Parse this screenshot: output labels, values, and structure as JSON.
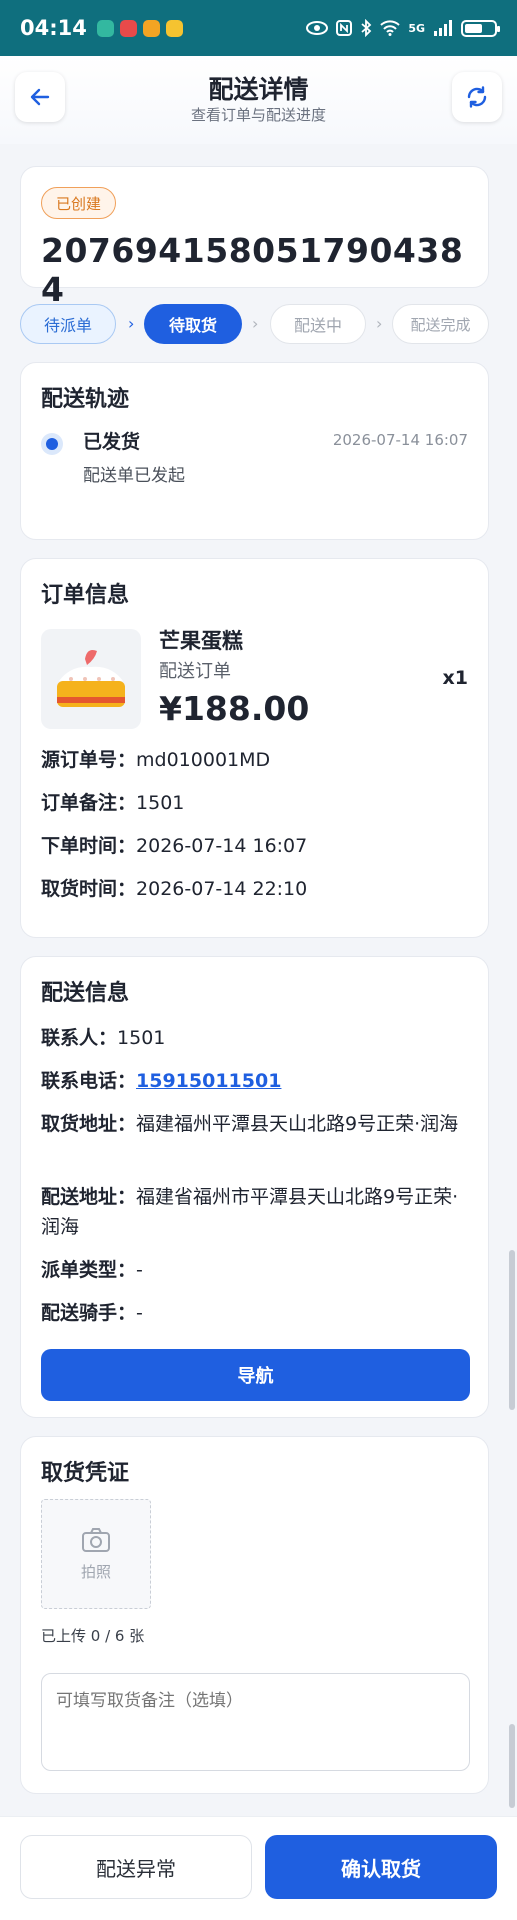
{
  "status_bar": {
    "time": "04:14",
    "network": "5G"
  },
  "header": {
    "title": "配送详情",
    "subtitle": "查看订单与配送进度"
  },
  "summary": {
    "badge": "已创建",
    "order_number": "207694158051790438 4"
  },
  "steps": [
    {
      "label": "待派单",
      "state": "done"
    },
    {
      "label": "待取货",
      "state": "active"
    },
    {
      "label": "配送中",
      "state": "todo"
    },
    {
      "label": "配送完成",
      "state": "todo"
    }
  ],
  "track": {
    "title": "配送轨迹",
    "event_title": "已发货",
    "event_desc": "配送单已发起",
    "event_time": "2026-07-14 16:07"
  },
  "order_info": {
    "title": "订单信息",
    "product_name": "芒果蛋糕",
    "product_type": "配送订单",
    "price": "¥188.00",
    "quantity": "x1",
    "fields": [
      {
        "key": "源订单号：",
        "value": "md010001MD"
      },
      {
        "key": "订单备注：",
        "value": "1501"
      },
      {
        "key": "下单时间：",
        "value": "2026-07-14 16:07"
      },
      {
        "key": "取货时间：",
        "value": "2026-07-14 22:10"
      }
    ]
  },
  "delivery_info": {
    "title": "配送信息",
    "contact_key": "联系人：",
    "contact_value": "1501",
    "phone_key": "联系电话：",
    "phone_value": "15915011501",
    "pickup_key": "取货地址：",
    "pickup_value": "福建福州平潭县天山北路9号正荣·润海",
    "dest_key": "配送地址：",
    "dest_value": "福建省福州市平潭县天山北路9号正荣·润海",
    "dispatch_key": "派单类型：",
    "dispatch_value": "-",
    "rider_key": "配送骑手：",
    "rider_value": "-",
    "nav_label": "导航"
  },
  "pickup_proof": {
    "title": "取货凭证",
    "photo_label": "拍照",
    "upload_count": "已上传 0 / 6 张",
    "note_placeholder": "可填写取货备注（选填）"
  },
  "bottom": {
    "exception_label": "配送异常",
    "confirm_label": "确认取货"
  },
  "colors": {
    "primary": "#1f5fe0",
    "status_bar": "#0f6f7e",
    "badge": "#d9781f"
  }
}
